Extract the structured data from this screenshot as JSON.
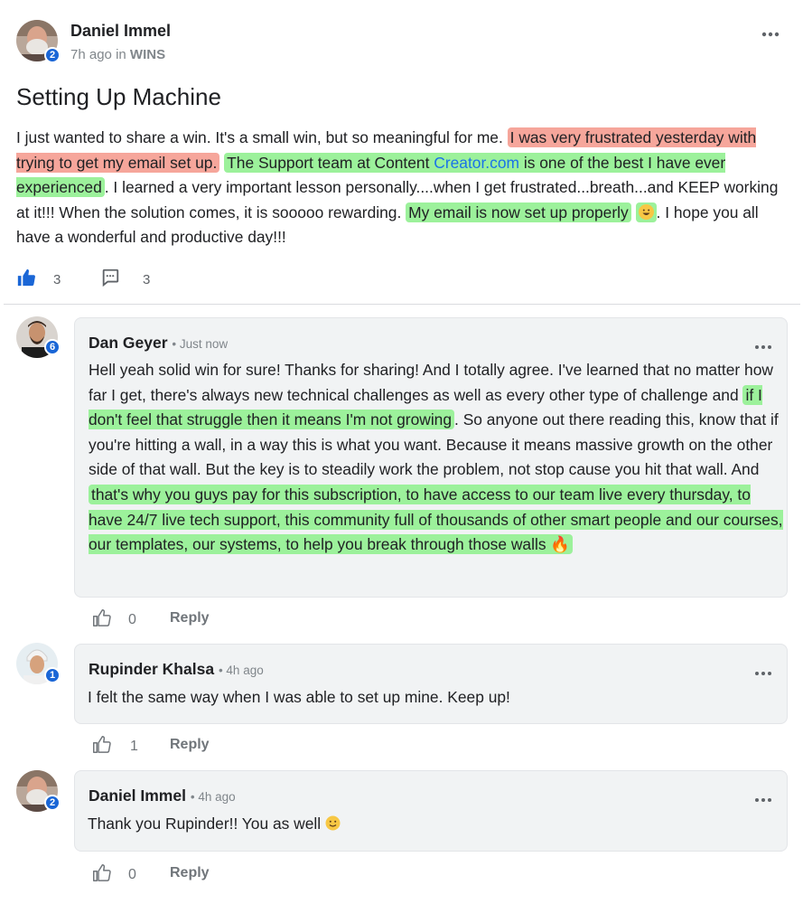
{
  "post": {
    "author": "Daniel Immel",
    "author_level": "2",
    "time": "7h ago",
    "in_word": "in",
    "category": "WINS",
    "title": "Setting Up Machine",
    "body": {
      "s1": "I just wanted to share a win.  It's a small win, but so meaningful for me. ",
      "h1": "I was very frustrated yesterday with trying to get my email set up.",
      "s2": " ",
      "h2a": "The Support team at Content ",
      "link": "Creator.com",
      "h2b": " is one of the best I have ever experienced",
      "s3": ".  I learned a very important lesson personally....when I get frustrated...breath...and KEEP working at it!!! When the solution comes, it is sooooo rewarding.  ",
      "h3": "My email is now set up properly",
      "s4": ". I hope you all have a wonderful and productive day!!!"
    },
    "likes": "3",
    "comments": "3"
  },
  "comments": [
    {
      "author": "Dan Geyer",
      "level": "6",
      "time": "Just now",
      "text": {
        "t1": "Hell yeah solid win for sure! Thanks for sharing! And I totally agree. I've learned that no matter how far I get, there's always new technical challenges as well as every other type of challenge and ",
        "g1": "if I don't feel that struggle then it means I'm not growing",
        "t2": ". So anyone out there reading this, know that if you're hitting a wall, in a way this is what you want. Because it means massive growth on the other side of that wall. But the key is to steadily work the problem, not stop cause you hit that wall. And ",
        "g2": "that's why you guys pay for this subscription, to have access to our team live every thursday, to have 24/7 live tech support, this community full of thousands of other smart people and our courses, our templates, our systems, to help you break through those walls 🔥"
      },
      "likes": "0",
      "reply": "Reply"
    },
    {
      "author": "Rupinder Khalsa",
      "level": "1",
      "time": "4h ago",
      "text": "I felt the same way when I was able to set up mine. Keep up!",
      "likes": "1",
      "reply": "Reply"
    },
    {
      "author": "Daniel Immel",
      "level": "2",
      "time": "4h ago",
      "text": "Thank you Rupinder!! You as well",
      "likes": "0",
      "reply": "Reply"
    }
  ],
  "ui": {
    "more_icon": "more-horizontal-icon",
    "like_icon": "thumbs-up-icon",
    "comment_icon": "comment-icon",
    "accent": "#1a66d6",
    "highlight_red": "#f6a69b",
    "highlight_green": "#9cf19b",
    "link_color": "#1a73e8"
  }
}
